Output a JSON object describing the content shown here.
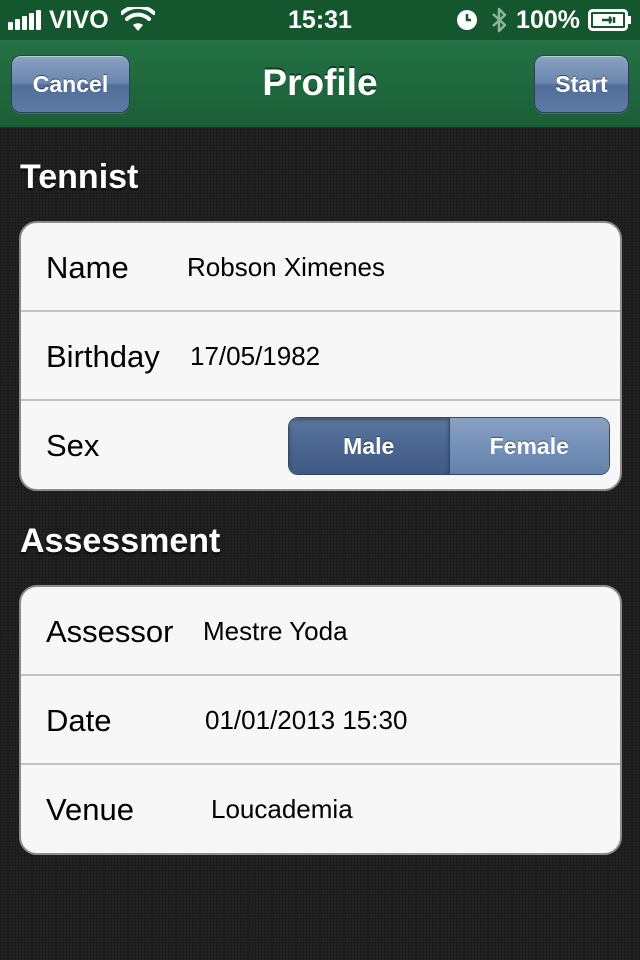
{
  "status_bar": {
    "carrier": "VIVO",
    "time": "15:31",
    "battery": "100%",
    "icons": [
      "signal-icon",
      "wifi-icon",
      "clock-icon",
      "bluetooth-icon",
      "battery-charging-icon"
    ]
  },
  "nav": {
    "title": "Profile",
    "cancel_label": "Cancel",
    "start_label": "Start"
  },
  "tennist": {
    "header": "Tennist",
    "name_label": "Name",
    "name_value": "Robson Ximenes",
    "birthday_label": "Birthday",
    "birthday_value": "17/05/1982",
    "sex_label": "Sex",
    "sex_options": [
      "Male",
      "Female"
    ],
    "sex_selected": "Male"
  },
  "assessment": {
    "header": "Assessment",
    "assessor_label": "Assessor",
    "assessor_value": "Mestre Yoda",
    "date_label": "Date",
    "date_value": "01/01/2013 15:30",
    "venue_label": "Venue",
    "venue_value": "Loucademia"
  },
  "colors": {
    "nav_green": "#1f6a3d",
    "button_blue": "#5c7aa3",
    "background": "#1f1f20",
    "cell_background": "#f7f7f7"
  }
}
